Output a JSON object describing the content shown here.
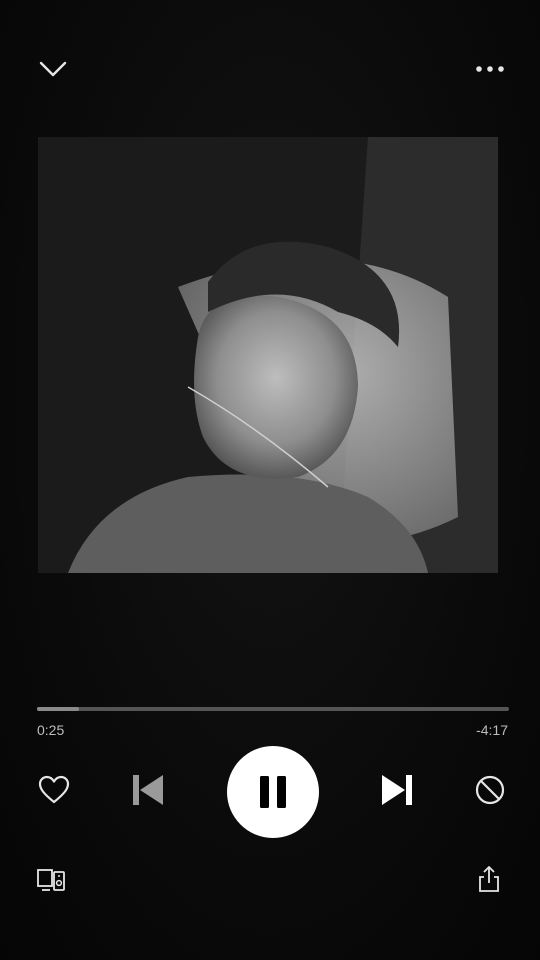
{
  "header": {
    "collapse_icon": "chevron-down-icon",
    "menu_icon": "more-horizontal-icon"
  },
  "artwork": {
    "kind": "grayscale album cover photo"
  },
  "playback": {
    "elapsed": "0:25",
    "remaining": "-4:17",
    "progress_fraction": 0.088,
    "state": "playing"
  },
  "controls": {
    "like_icon": "heart-icon",
    "previous_icon": "skip-previous-icon",
    "pause_icon": "pause-icon",
    "next_icon": "skip-next-icon",
    "block_icon": "block-icon"
  },
  "footer": {
    "devices_icon": "connect-devices-icon",
    "share_icon": "share-icon"
  },
  "colors": {
    "background": "#0b0b0b",
    "icon": "#e6e6e6",
    "track": "#555555",
    "track_fill": "#8a8a8a",
    "play_button": "#ffffff"
  }
}
